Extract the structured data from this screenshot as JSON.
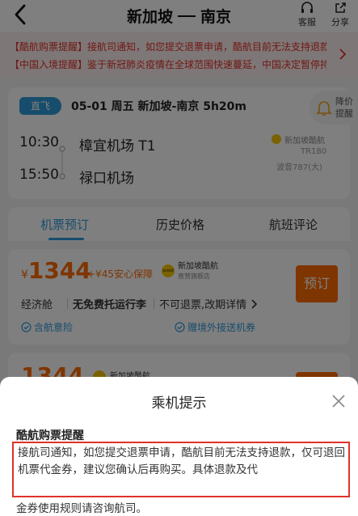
{
  "header": {
    "origin": "新加坡",
    "destination": "南京",
    "service_label": "客服",
    "share_label": "分享"
  },
  "notices": [
    "【酷航购票提醒】接航司通知，如您提交退票申请，酷航目前无法支持退款，仅可退回机票代金券",
    "【中国入境提醒】鉴于新冠肺炎疫情在全球范围快速蔓延，中国决定暂停持有效签证、居留许可的外国人入境"
  ],
  "flight": {
    "badge": "直飞",
    "meta": "05-01 周五 新加坡-南京 5h20m",
    "price_alert_label": "降价提醒",
    "departure_time": "10:30",
    "departure_airport": "樟宜机场 T1",
    "arrival_time": "15:50",
    "arrival_airport": "禄口机场",
    "airline": "新加坡酷航",
    "flight_number": "TR180",
    "aircraft": "波音787(大)"
  },
  "tabs": [
    "机票预订",
    "历史价格",
    "航班评论"
  ],
  "ticket": {
    "currency": "¥",
    "price": "1344",
    "addon": "+¥45安心保障",
    "logo_text": "scoot",
    "store_name": "新加坡酷航",
    "store_sub": "直营旗舰店",
    "book_label": "预订",
    "cabin": "经济舱",
    "baggage": "无免费托运行李",
    "refund_policy": "不可退票,改期详情",
    "perk_1": "含航意险",
    "perk_2": "赠境外接送机券"
  },
  "ticket2": {
    "price": "1344",
    "store_name": "新加坡酷航"
  },
  "sheet": {
    "title": "乘机提示",
    "heading": "酷航购票提醒",
    "body": "接航司通知，如您提交退票申请，酷航目前无法支持退款，仅可退回机票代金券，建议您确认后再购买。具体退款及代",
    "tail": "金券使用规则请咨询航司。"
  },
  "colors": {
    "accent_blue": "#2f9ad8",
    "accent_orange": "#ff6a00",
    "alert_red": "#e0322a"
  }
}
